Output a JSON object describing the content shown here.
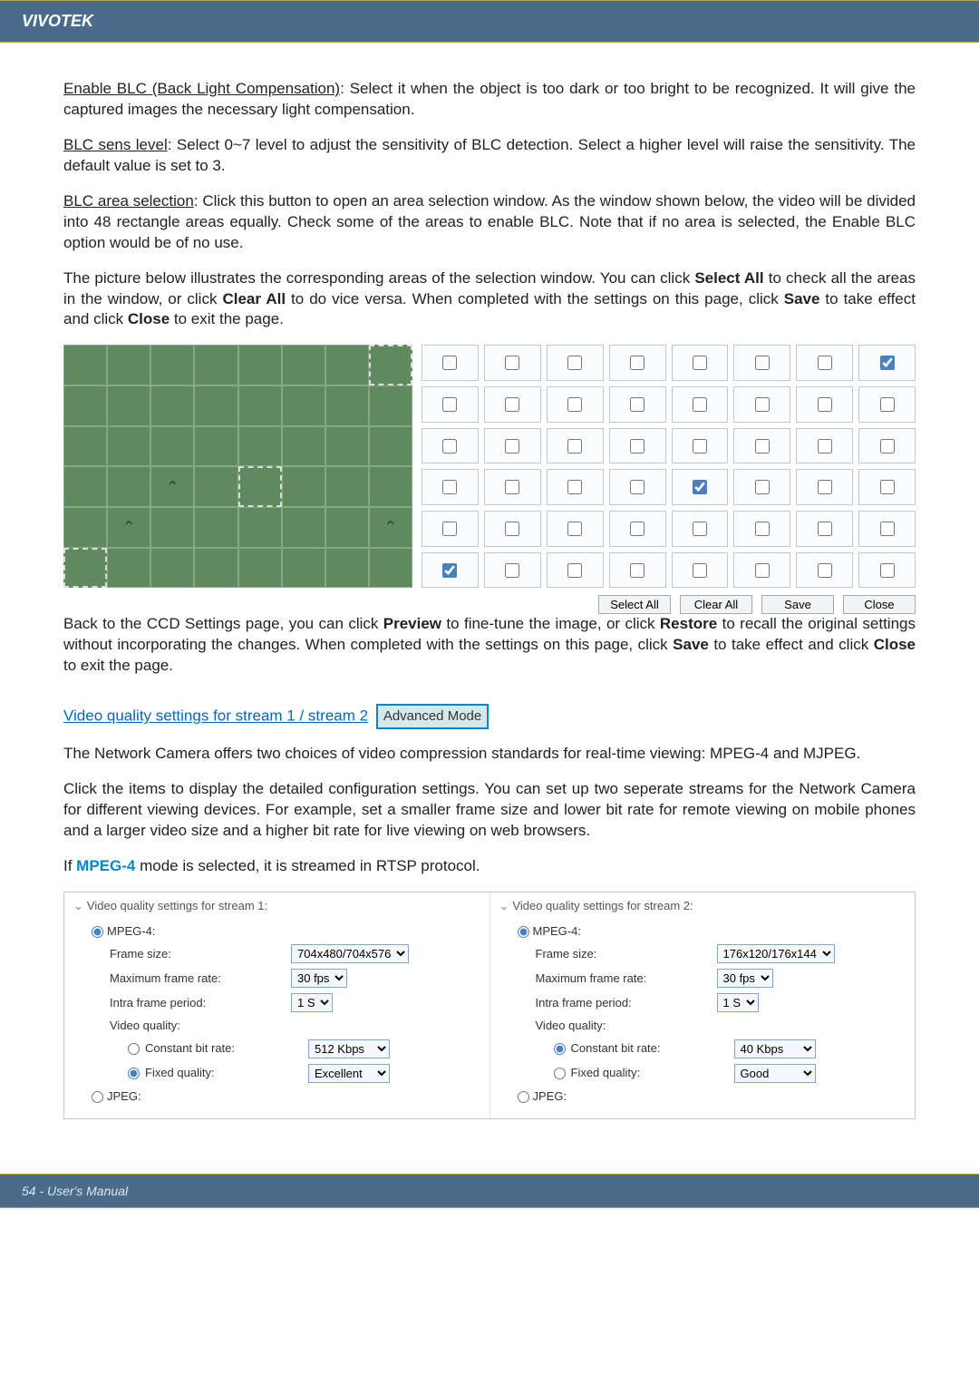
{
  "header": {
    "brand": "VIVOTEK"
  },
  "footer": {
    "text": "54 - User's Manual"
  },
  "paragraphs": {
    "blc_enable_label": "Enable BLC (Back Light Compensation)",
    "blc_enable_text": ": Select it when the object is too dark or too bright to be recognized. It will give the captured images the necessary light compensation.",
    "blc_sens_label": "BLC sens level",
    "blc_sens_text": ": Select 0~7 level to adjust the sensitivity of BLC detection. Select a higher level will raise the sensitivity. The default value is set to 3.",
    "blc_area_label": "BLC area selection",
    "blc_area_text": ": Click this button to open an area selection window. As the window shown below, the video will be divided into 48 rectangle areas equally. Check some of the areas to enable BLC. Note that if no area is selected, the Enable BLC option would be of no use.",
    "p4a": "The picture below illustrates the corresponding areas of the selection window. You can click ",
    "p4_select_all": "Select All",
    "p4b": " to check all the areas in the window, or click ",
    "p4_clear_all": "Clear All",
    "p4c": " to do vice versa. When completed with the settings on this page, click ",
    "p4_save": "Save",
    "p4d": " to take effect and click ",
    "p4_close": "Close",
    "p4e": " to exit the page.",
    "p5a": "Back to the CCD Settings page, you can click ",
    "p5_preview": "Preview",
    "p5b": " to fine-tune the image, or click ",
    "p5_restore": "Restore",
    "p5c": " to recall the original settings without incorporating the changes. When completed with the settings on this page, click ",
    "p5_save": "Save",
    "p5d": " to take effect and click ",
    "p5_close": "Close",
    "p5e": " to exit the page.",
    "vq_link": "Video quality settings for stream 1 / stream 2",
    "adv_mode": "Advanced Mode",
    "vq_intro": "The Network Camera offers two choices of video compression standards for real-time viewing: MPEG-4 and MJPEG.",
    "vq_detail": "Click the items to display the detailed configuration settings. You can set up two seperate streams for the Network Camera for different viewing devices. For example, set a smaller frame size and lower bit rate for remote viewing on mobile phones and a larger video size and a higher bit rate for live viewing on web browsers.",
    "mpeg4_note_a": "If ",
    "mpeg4_note_b": "MPEG-4",
    "mpeg4_note_c": " mode is selected, it is streamed in RTSP protocol."
  },
  "blc_grid": {
    "checked": [
      [
        0,
        7
      ],
      [
        3,
        4
      ],
      [
        5,
        0
      ]
    ],
    "buttons": {
      "select_all": "Select All",
      "clear_all": "Clear All",
      "save": "Save",
      "close": "Close"
    }
  },
  "vq": {
    "s1": {
      "title": "Video quality settings for stream 1:",
      "mpeg4": "MPEG-4:",
      "frame_size_lbl": "Frame size:",
      "frame_size_val": "704x480/704x576",
      "max_fr_lbl": "Maximum frame rate:",
      "max_fr_val": "30 fps",
      "intra_lbl": "Intra frame period:",
      "intra_val": "1 S",
      "vq_lbl": "Video quality:",
      "cbr_lbl": "Constant bit rate:",
      "cbr_val": "512 Kbps",
      "fq_lbl": "Fixed quality:",
      "fq_val": "Excellent",
      "jpeg": "JPEG:"
    },
    "s2": {
      "title": "Video quality settings for stream 2:",
      "mpeg4": "MPEG-4:",
      "frame_size_lbl": "Frame size:",
      "frame_size_val": "176x120/176x144",
      "max_fr_lbl": "Maximum frame rate:",
      "max_fr_val": "30 fps",
      "intra_lbl": "Intra frame period:",
      "intra_val": "1 S",
      "vq_lbl": "Video quality:",
      "cbr_lbl": "Constant bit rate:",
      "cbr_val": "40 Kbps",
      "fq_lbl": "Fixed quality:",
      "fq_val": "Good",
      "jpeg": "JPEG:"
    }
  }
}
